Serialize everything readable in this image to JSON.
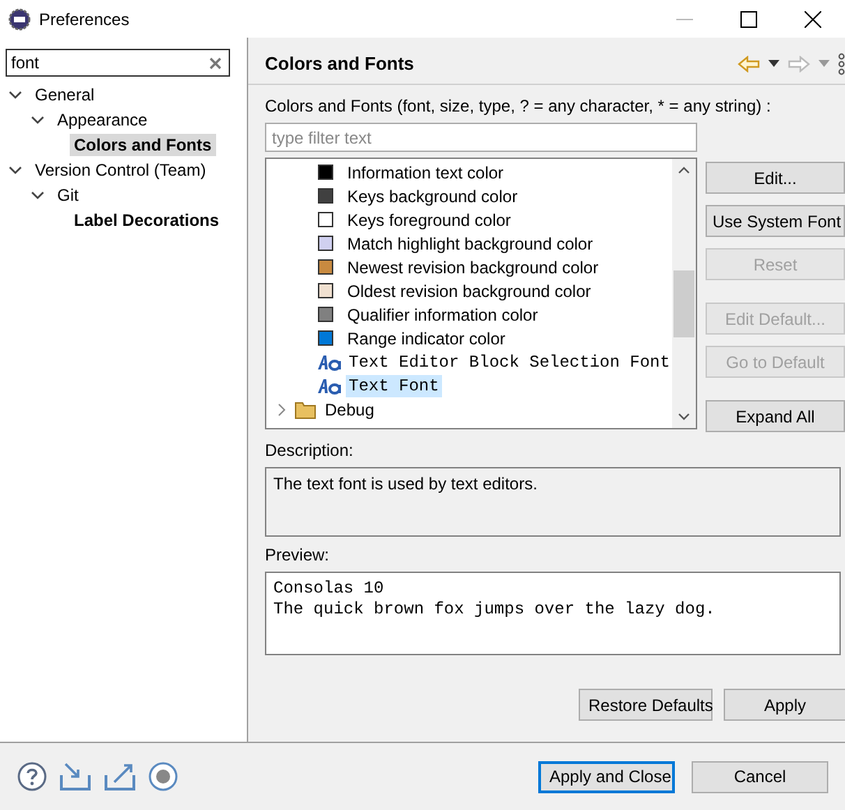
{
  "window": {
    "title": "Preferences"
  },
  "sidebar": {
    "search": {
      "value": "font"
    },
    "tree": [
      {
        "label": "General",
        "expanded": true,
        "selected": false,
        "match": false,
        "children": [
          {
            "label": "Appearance",
            "expanded": true,
            "selected": false,
            "match": false,
            "children": [
              {
                "label": "Colors and Fonts",
                "selected": true,
                "match": true
              }
            ]
          }
        ]
      },
      {
        "label": "Version Control (Team)",
        "expanded": true,
        "selected": false,
        "match": false,
        "children": [
          {
            "label": "Git",
            "expanded": true,
            "selected": false,
            "match": false,
            "children": [
              {
                "label": "Label Decorations",
                "selected": false,
                "match": true
              }
            ]
          }
        ]
      }
    ]
  },
  "page": {
    "title": "Colors and Fonts",
    "description_label": "Colors and Fonts (font, size, type, ? = any character, * = any string) :",
    "filter": {
      "placeholder": "type filter text"
    },
    "items": [
      {
        "kind": "color",
        "label": "Information text color",
        "color": "#000000",
        "selected": false
      },
      {
        "kind": "color",
        "label": "Keys background color",
        "color": "#404040",
        "selected": false
      },
      {
        "kind": "color",
        "label": "Keys foreground color",
        "color": "#ffffff",
        "selected": false
      },
      {
        "kind": "color",
        "label": "Match highlight background color",
        "color": "#d0d0f0",
        "selected": false
      },
      {
        "kind": "color",
        "label": "Newest revision background color",
        "color": "#c88a40",
        "selected": false
      },
      {
        "kind": "color",
        "label": "Oldest revision background color",
        "color": "#f0e0d0",
        "selected": false
      },
      {
        "kind": "color",
        "label": "Qualifier information color",
        "color": "#808080",
        "selected": false
      },
      {
        "kind": "color",
        "label": "Range indicator color",
        "color": "#0078d7",
        "selected": false
      },
      {
        "kind": "font",
        "label": "Text Editor Block Selection Font",
        "selected": false
      },
      {
        "kind": "font",
        "label": "Text Font",
        "selected": true
      },
      {
        "kind": "folder",
        "label": "Debug",
        "selected": false
      }
    ],
    "side_buttons": [
      {
        "label": "Edit...",
        "disabled": false
      },
      {
        "label": "Use System Font",
        "disabled": false
      },
      {
        "label": "Reset",
        "disabled": true
      },
      {
        "label": "Edit Default...",
        "disabled": true,
        "gap": true
      },
      {
        "label": "Go to Default",
        "disabled": true
      },
      {
        "label": "Expand All",
        "disabled": false,
        "gap": true
      }
    ],
    "description": {
      "label": "Description:",
      "text": "The text font is used by text editors."
    },
    "preview": {
      "label": "Preview:",
      "lines": [
        "Consolas 10",
        "The quick brown fox jumps over the lazy dog."
      ]
    },
    "buttons": [
      "Restore Defaults",
      "Apply"
    ]
  },
  "footer": {
    "buttons": [
      {
        "label": "Apply and Close",
        "default": true
      },
      {
        "label": "Cancel",
        "default": false
      }
    ]
  }
}
